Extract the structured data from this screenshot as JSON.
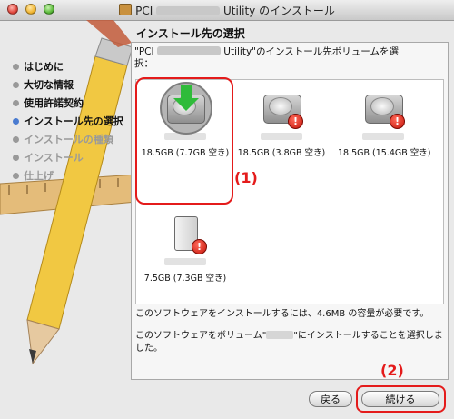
{
  "window": {
    "title_prefix": "PCI",
    "title_suffix": "Utility のインストール"
  },
  "sidebar": {
    "steps": [
      {
        "label": "はじめに",
        "state": "done"
      },
      {
        "label": "大切な情報",
        "state": "done"
      },
      {
        "label": "使用許諾契約",
        "state": "done"
      },
      {
        "label": "インストール先の選択",
        "state": "current"
      },
      {
        "label": "インストールの種類",
        "state": "pending"
      },
      {
        "label": "インストール",
        "state": "pending"
      },
      {
        "label": "仕上げ",
        "state": "pending"
      }
    ]
  },
  "main": {
    "section_title": "インストール先の選択",
    "instruction_line1_prefix": "\"PCI",
    "instruction_line1_suffix": "Utility\"のインストール先ボリュームを選",
    "instruction_line2": "択：",
    "volumes": [
      {
        "capacity": "18.5GB (7.7GB 空き)",
        "selected": true,
        "icon": "internal-disk-icon",
        "status": "install-arrow"
      },
      {
        "capacity": "18.5GB (3.8GB 空き)",
        "selected": false,
        "icon": "internal-disk-icon",
        "status": "warning"
      },
      {
        "capacity": "18.5GB (15.4GB 空き)",
        "selected": false,
        "icon": "internal-disk-icon",
        "status": "warning"
      },
      {
        "capacity": "7.5GB (7.3GB 空き)",
        "selected": false,
        "icon": "external-disk-icon",
        "status": "warning"
      }
    ],
    "info_line1": "このソフトウェアをインストールするには、4.6MB の容量が必要です。",
    "info_line2_prefix": "このソフトウェアをボリューム\"",
    "info_line2_suffix": "\"にインストールすることを選択しました。"
  },
  "annotations": {
    "mark1": "(1)",
    "mark2": "(2)"
  },
  "buttons": {
    "back": "戻る",
    "continue": "続ける"
  },
  "colors": {
    "highlight": "#e41b1b",
    "active_bullet": "#4a7bd0"
  }
}
